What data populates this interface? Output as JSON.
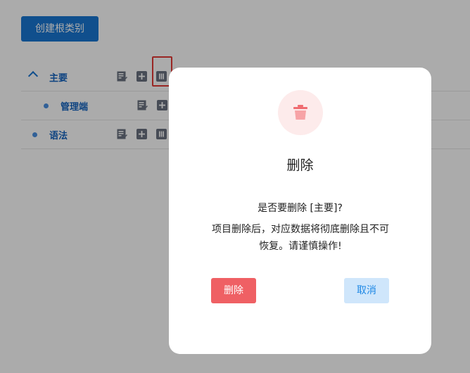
{
  "page": {
    "create_root_label": "创建根类别"
  },
  "tree": {
    "nodes": [
      {
        "label": "主要",
        "expanded": true,
        "level": 0
      },
      {
        "label": "管理端",
        "level": 1
      },
      {
        "label": "语法",
        "level": 0
      }
    ]
  },
  "dialog": {
    "title": "删除",
    "question": "是否要删除 [主要]?",
    "warning": "项目删除后，对应数据将彻底删除且不可恢复。请谨慎操作!",
    "delete_label": "删除",
    "cancel_label": "取消"
  },
  "icons": {
    "edit": "edit-note-icon",
    "add": "add-box-icon",
    "delete": "delete-icon",
    "expand": "chevron-up-icon",
    "dialog": "trash-icon"
  },
  "colors": {
    "primary": "#1976d2",
    "danger": "#ef6064",
    "cancel_bg": "#cfe6fb",
    "cancel_text": "#1e88e5",
    "highlight": "#e53935"
  }
}
